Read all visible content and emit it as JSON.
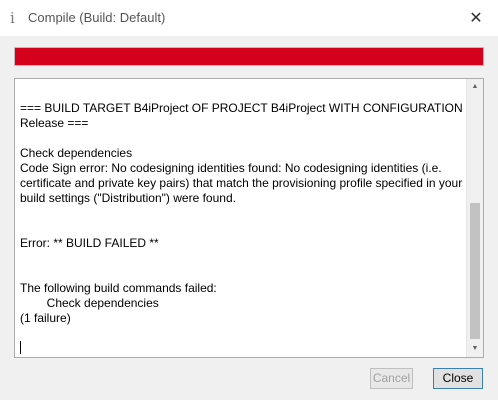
{
  "window": {
    "icon_glyph": "i",
    "title": "Compile (Build: Default)",
    "close_glyph": "✕"
  },
  "progress": {
    "fraction": 1.0,
    "color": "#d5001c",
    "state": "error"
  },
  "log": {
    "text": "    \n\n=== BUILD TARGET B4iProject OF PROJECT B4iProject WITH CONFIGURATION Release ===\n\nCheck dependencies\nCode Sign error: No codesigning identities found: No codesigning identities (i.e. certificate and private key pairs) that match the provisioning profile specified in your build settings (\"Distribution\") were found.\n\n\nError: ** BUILD FAILED **\n\n\nThe following build commands failed:\n\tCheck dependencies\n(1 failure)"
  },
  "scrollbar": {
    "up_glyph": "▲",
    "down_glyph": "▼"
  },
  "buttons": {
    "cancel_label": "Cancel",
    "close_label": "Close"
  }
}
